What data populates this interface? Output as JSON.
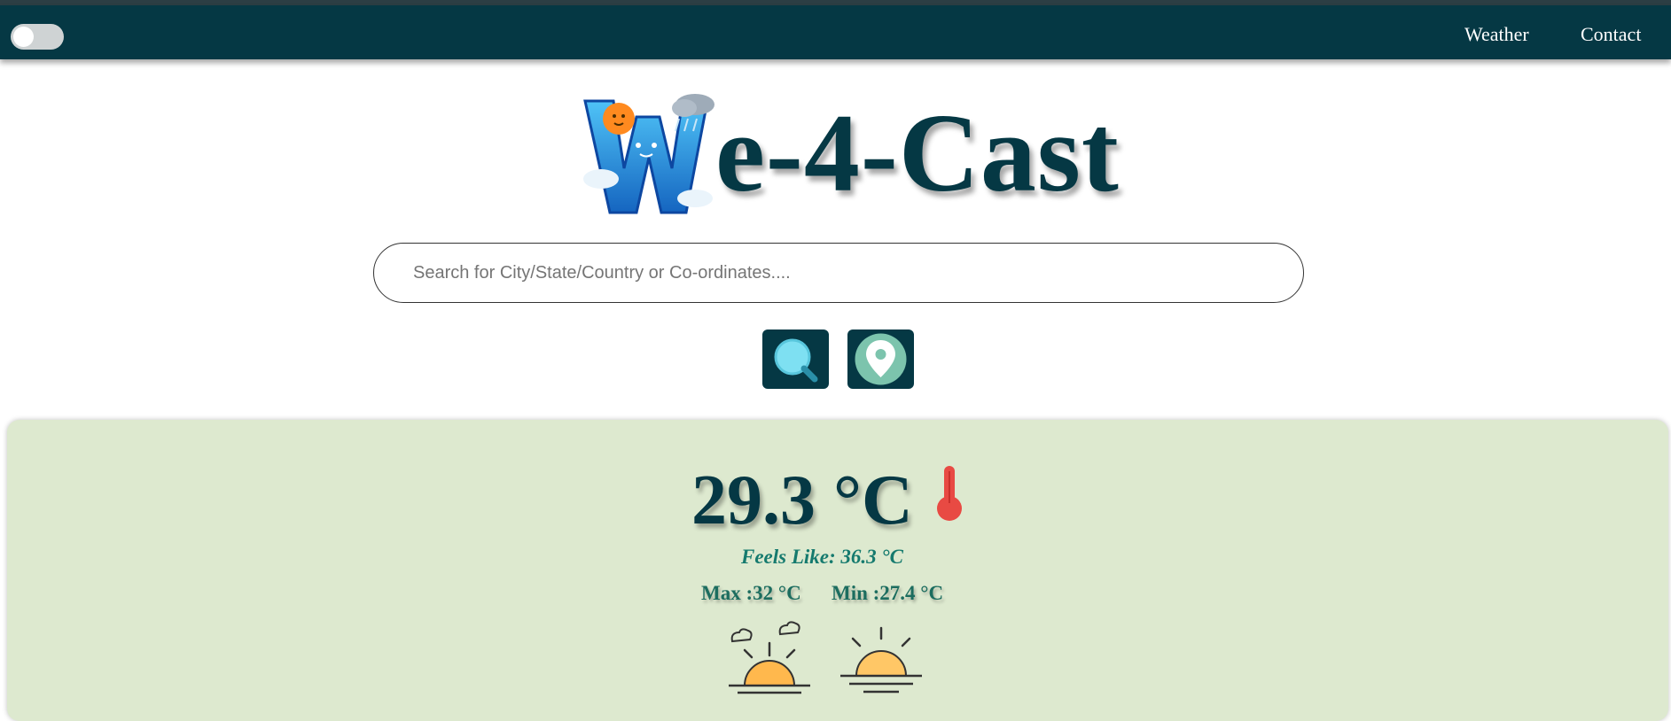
{
  "navbar": {
    "theme_toggle": "off",
    "links": [
      {
        "label": "Weather"
      },
      {
        "label": "Contact"
      }
    ]
  },
  "logo": {
    "text": "e-4-Cast"
  },
  "search": {
    "placeholder": "Search for City/State/Country or Co-ordinates....",
    "value": ""
  },
  "buttons": {
    "search_icon": "magnifier-icon",
    "location_icon": "location-pin-icon"
  },
  "weather": {
    "temperature": "29.3 °C",
    "feels_like": "Feels Like: 36.3 °C",
    "max": "Max :32 °C",
    "min": "Min :27.4 °C"
  },
  "colors": {
    "navbar": "#053844",
    "card": "#dde9cf",
    "accent": "#157a6e",
    "thermometer": "#e84a43"
  }
}
